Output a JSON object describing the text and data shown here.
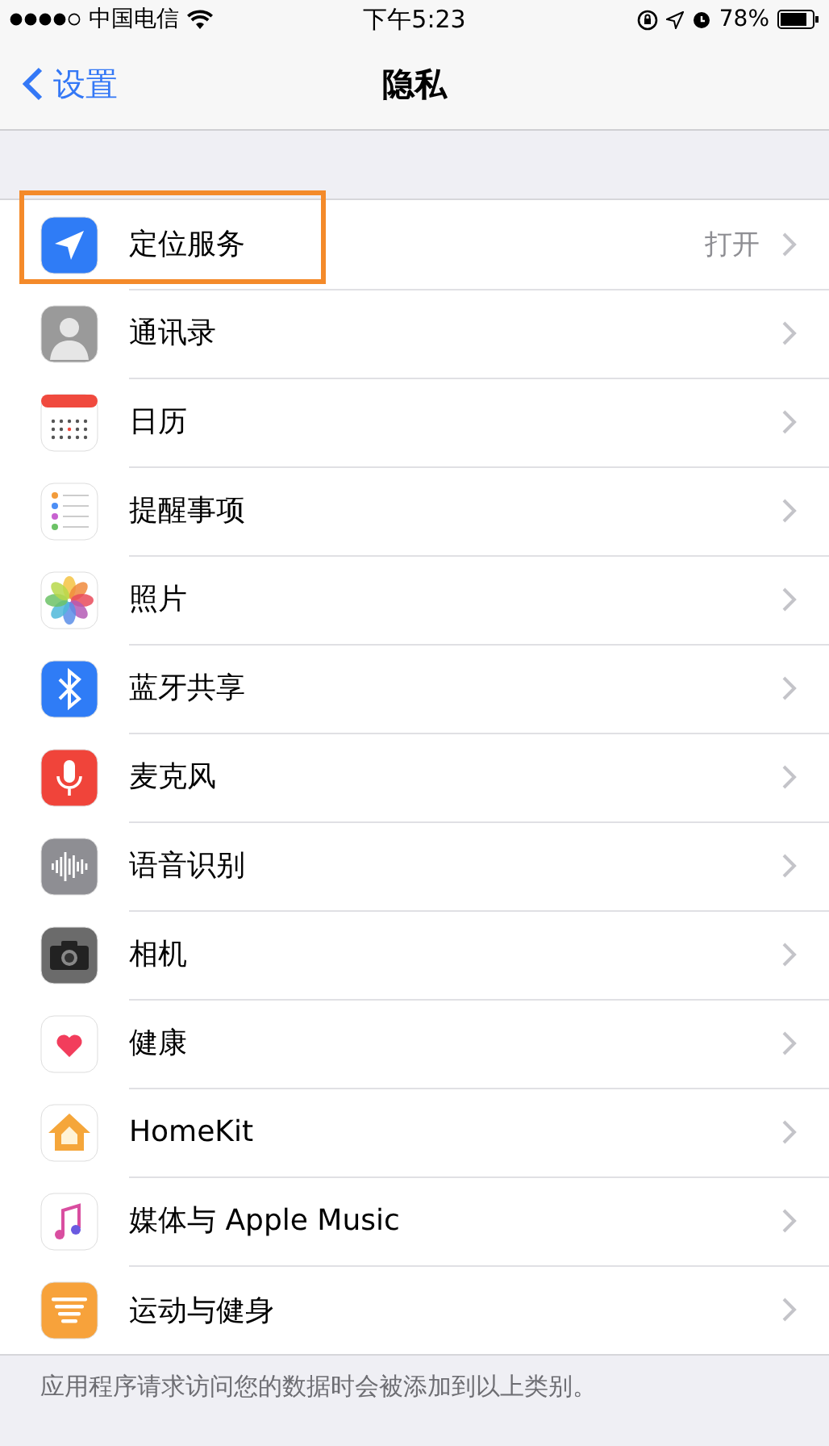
{
  "status_bar": {
    "carrier": "中国电信",
    "time": "下午5:23",
    "battery": "78%"
  },
  "nav": {
    "back": "设置",
    "title": "隐私"
  },
  "rows": [
    {
      "label": "定位服务",
      "value": "打开",
      "highlighted": true
    },
    {
      "label": "通讯录",
      "highlighted": false
    },
    {
      "label": "日历",
      "highlighted": false
    },
    {
      "label": "提醒事项",
      "highlighted": false
    },
    {
      "label": "照片",
      "highlighted": false
    },
    {
      "label": "蓝牙共享",
      "highlighted": false
    },
    {
      "label": "麦克风",
      "highlighted": false
    },
    {
      "label": "语音识别",
      "highlighted": false
    },
    {
      "label": "相机",
      "highlighted": false
    },
    {
      "label": "健康",
      "highlighted": false
    },
    {
      "label": "HomeKit",
      "highlighted": false
    },
    {
      "label": "媒体与 Apple Music",
      "highlighted": false
    },
    {
      "label": "运动与健身",
      "highlighted": false
    }
  ],
  "footer": "应用程序请求访问您的数据时会被添加到以上类别。"
}
